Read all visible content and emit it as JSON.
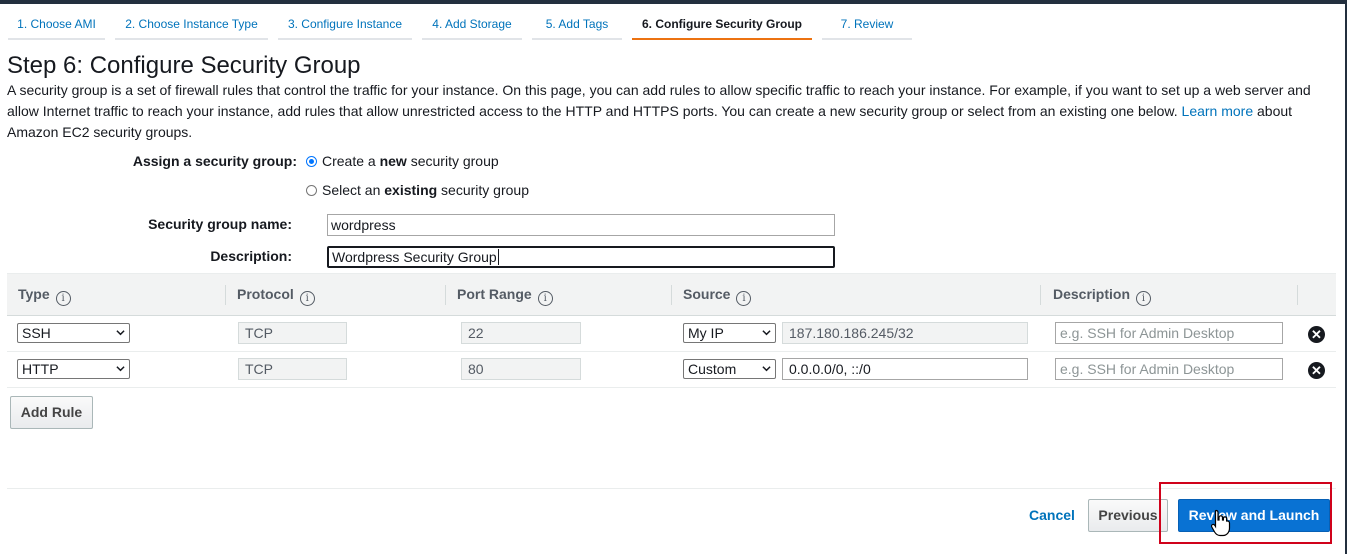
{
  "wizard_tabs": [
    {
      "label": "1. Choose AMI"
    },
    {
      "label": "2. Choose Instance Type"
    },
    {
      "label": "3. Configure Instance"
    },
    {
      "label": "4. Add Storage"
    },
    {
      "label": "5. Add Tags"
    },
    {
      "label": "6. Configure Security Group",
      "active": true
    },
    {
      "label": "7. Review"
    }
  ],
  "page": {
    "title": "Step 6: Configure Security Group",
    "intro": "A security group is a set of firewall rules that control the traffic for your instance. On this page, you can add rules to allow specific traffic to reach your instance. For example, if you want to set up a web server and allow Internet traffic to reach your instance, add rules that allow unrestricted access to the HTTP and HTTPS ports. You can create a new security group or select from an existing one below.",
    "learn_more": "Learn more",
    "intro_suffix": "about Amazon EC2 security groups."
  },
  "form": {
    "assign_label": "Assign a security group:",
    "option_create": {
      "prefix": "Create a ",
      "bold": "new",
      "suffix": " security group",
      "selected": true
    },
    "option_existing": {
      "prefix": "Select an ",
      "bold": "existing",
      "suffix": " security group",
      "selected": false
    },
    "name_label": "Security group name:",
    "name_value": "wordpress",
    "description_label": "Description:",
    "description_value": "Wordpress Security Group"
  },
  "rules_table": {
    "columns": [
      "Type",
      "Protocol",
      "Port Range",
      "Source",
      "Description"
    ],
    "info_icon": "i",
    "rows": [
      {
        "type": "SSH",
        "protocol": "TCP",
        "port_range": "22",
        "source_type": "My IP",
        "source_value": "187.180.186.245/32",
        "description_placeholder": "e.g. SSH for Admin Desktop"
      },
      {
        "type": "HTTP",
        "protocol": "TCP",
        "port_range": "80",
        "source_type": "Custom",
        "source_value": "0.0.0.0/0, ::/0",
        "description_placeholder": "e.g. SSH for Admin Desktop"
      }
    ],
    "delete_icon": "✕"
  },
  "buttons": {
    "add_rule": "Add Rule",
    "cancel": "Cancel",
    "previous": "Previous",
    "review_launch": "Review and Launch"
  },
  "colors": {
    "link": "#0073bb",
    "active_tab": "#ec7211",
    "primary": "#0972d3",
    "highlight": "#d0021b"
  },
  "icons": [
    "info-icon",
    "chevron-down-icon",
    "remove-icon",
    "hand-cursor-icon"
  ]
}
